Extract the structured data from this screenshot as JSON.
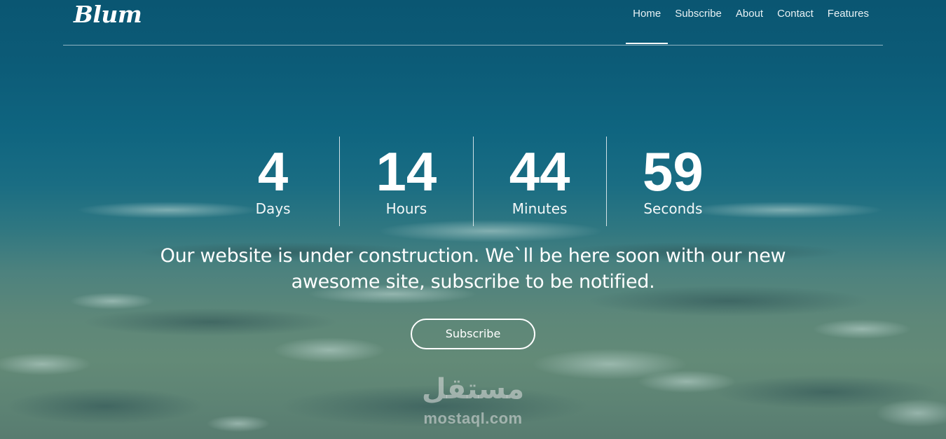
{
  "brand": {
    "logo_text": "Blum"
  },
  "nav": {
    "items": [
      {
        "label": "Home",
        "active": true
      },
      {
        "label": "Subscribe",
        "active": false
      },
      {
        "label": "About",
        "active": false
      },
      {
        "label": "Contact",
        "active": false
      },
      {
        "label": "Features",
        "active": false
      }
    ]
  },
  "countdown": {
    "days": {
      "value": "4",
      "label": "Days"
    },
    "hours": {
      "value": "14",
      "label": "Hours"
    },
    "minutes": {
      "value": "44",
      "label": "Minutes"
    },
    "seconds": {
      "value": "59",
      "label": "Seconds"
    }
  },
  "message": {
    "line1": "Our website is under construction. We`ll be here soon with our new",
    "line2": "awesome site, subscribe to be notified."
  },
  "cta": {
    "subscribe_label": "Subscribe"
  },
  "watermark": {
    "arabic_text": "مستقل",
    "site": "mostaql.com"
  },
  "colors": {
    "overlay_top": "#0a5672",
    "overlay_bottom": "#587c70",
    "text": "#ffffff"
  }
}
